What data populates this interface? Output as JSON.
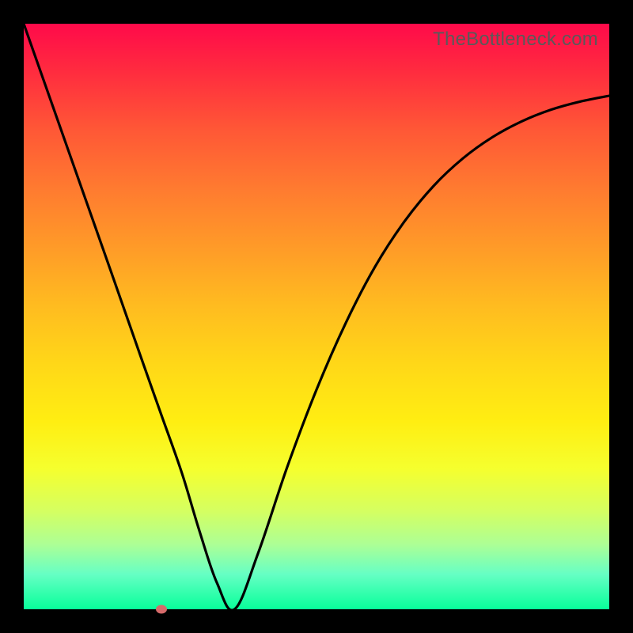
{
  "watermark": "TheBottleneck.com",
  "colors": {
    "page_bg": "#000000",
    "curve_stroke": "#000000",
    "marker_fill": "#d66a6a"
  },
  "chart_data": {
    "type": "line",
    "title": "",
    "xlabel": "",
    "ylabel": "",
    "xlim": [
      0,
      100
    ],
    "ylim": [
      0,
      100
    ],
    "grid": false,
    "legend": false,
    "series": [
      {
        "name": "bottleneck-curve",
        "x": [
          0,
          5,
          10,
          15,
          20,
          23.5,
          27,
          30,
          33,
          36,
          40,
          45,
          50,
          55,
          60,
          65,
          70,
          75,
          80,
          85,
          90,
          95,
          100
        ],
        "values": [
          100,
          85.8,
          71.6,
          57.4,
          43.1,
          33.2,
          23.3,
          13.4,
          4.5,
          0.0,
          9.5,
          24.3,
          37.5,
          48.9,
          58.5,
          66.2,
          72.3,
          77.0,
          80.6,
          83.3,
          85.3,
          86.7,
          87.7
        ]
      }
    ],
    "markers": [
      {
        "name": "optimum-point",
        "x": 23.5,
        "y": 0.0
      }
    ]
  }
}
